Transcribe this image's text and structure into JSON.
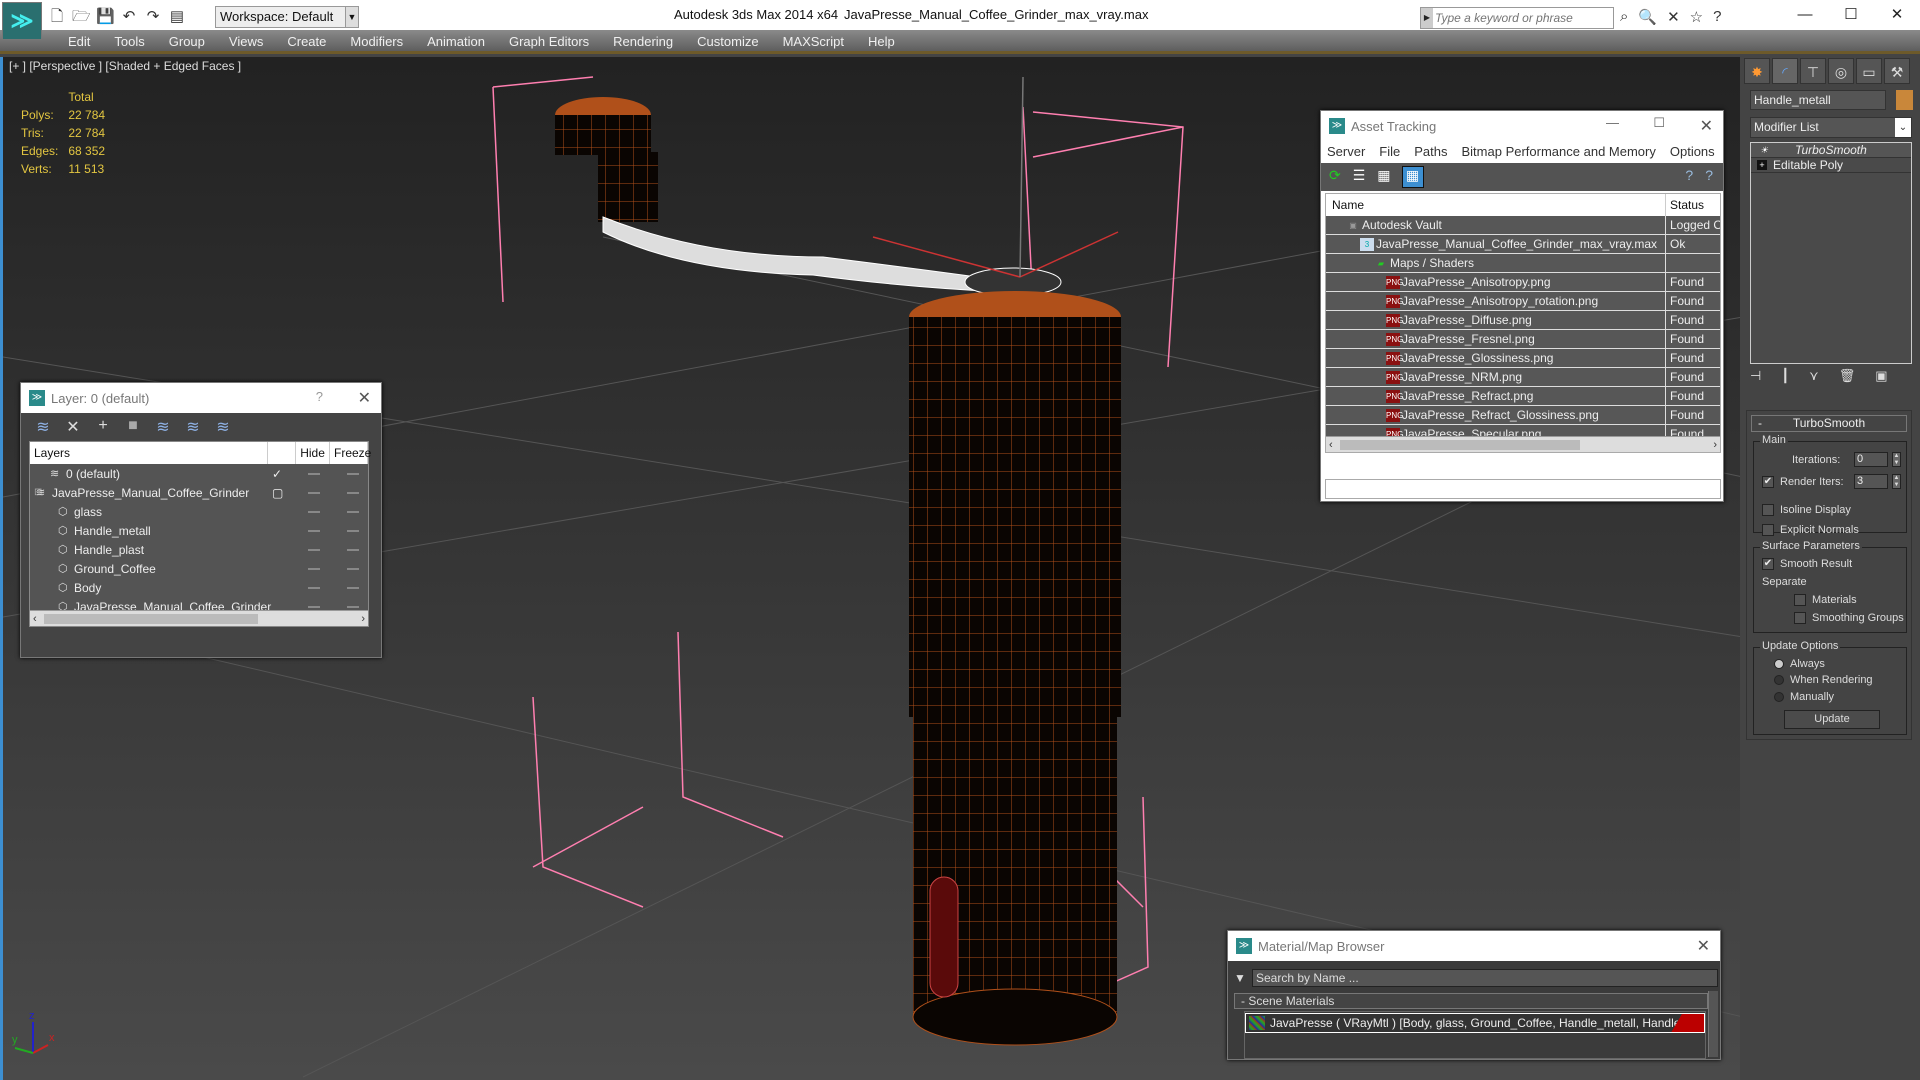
{
  "titlebar": {
    "app_title": "Autodesk 3ds Max  2014 x64",
    "file_title": "JavaPresse_Manual_Coffee_Grinder_max_vray.max",
    "workspace": "Workspace: Default",
    "search_placeholder": "Type a keyword or phrase",
    "quick_access_icons": [
      "new-file-icon",
      "open-file-icon",
      "save-icon",
      "undo-icon",
      "redo-icon",
      "project-folder-icon"
    ],
    "help_icons": [
      "binoculars-icon",
      "search-icon",
      "communication-icon",
      "favorites-icon",
      "help-icon"
    ],
    "window_controls": [
      "minimize",
      "maximize",
      "close"
    ]
  },
  "menu": [
    "Edit",
    "Tools",
    "Group",
    "Views",
    "Create",
    "Modifiers",
    "Animation",
    "Graph Editors",
    "Rendering",
    "Customize",
    "MAXScript",
    "Help"
  ],
  "viewport": {
    "label": "[+ ] [Perspective ] [Shaded + Edged Faces ]",
    "stats": {
      "header": "Total",
      "rows": [
        {
          "label": "Polys:",
          "value": "22 784"
        },
        {
          "label": "Tris:",
          "value": "22 784"
        },
        {
          "label": "Edges:",
          "value": "68 352"
        },
        {
          "label": "Verts:",
          "value": "11 513"
        }
      ]
    },
    "axis_labels": {
      "x": "x",
      "y": "y",
      "z": "z"
    }
  },
  "layer_panel": {
    "title": "Layer: 0 (default)",
    "help": "?",
    "columns": [
      "Layers",
      "Hide",
      "Freeze"
    ],
    "rows": [
      {
        "name": "0 (default)",
        "type": "layer",
        "indent": 1,
        "current": "check"
      },
      {
        "name": "JavaPresse_Manual_Coffee_Grinder",
        "type": "layer",
        "indent": 0,
        "current": "box",
        "expanded": true
      },
      {
        "name": "glass",
        "type": "object",
        "indent": 2
      },
      {
        "name": "Handle_metall",
        "type": "object",
        "indent": 2
      },
      {
        "name": "Handle_plast",
        "type": "object",
        "indent": 2
      },
      {
        "name": "Ground_Coffee",
        "type": "object",
        "indent": 2
      },
      {
        "name": "Body",
        "type": "object",
        "indent": 2
      },
      {
        "name": "JavaPresse_Manual_Coffee_Grinder",
        "type": "object",
        "indent": 2
      }
    ]
  },
  "asset_tracking": {
    "title": "Asset Tracking",
    "menu": [
      "Server",
      "File",
      "Paths",
      "Bitmap Performance and Memory",
      "Options"
    ],
    "columns": [
      "Name",
      "Status"
    ],
    "rows": [
      {
        "name": "Autodesk Vault",
        "status": "Logged Out",
        "icon": "vault",
        "indent": 0
      },
      {
        "name": "JavaPresse_Manual_Coffee_Grinder_max_vray.max",
        "status": "Ok",
        "icon": "max",
        "indent": 1
      },
      {
        "name": "Maps / Shaders",
        "status": "",
        "icon": "maps",
        "indent": 2
      },
      {
        "name": "JavaPresse_Anisotropy.png",
        "status": "Found",
        "icon": "png",
        "indent": 3
      },
      {
        "name": "JavaPresse_Anisotropy_rotation.png",
        "status": "Found",
        "icon": "png",
        "indent": 3
      },
      {
        "name": "JavaPresse_Diffuse.png",
        "status": "Found",
        "icon": "png",
        "indent": 3
      },
      {
        "name": "JavaPresse_Fresnel.png",
        "status": "Found",
        "icon": "png",
        "indent": 3
      },
      {
        "name": "JavaPresse_Glossiness.png",
        "status": "Found",
        "icon": "png",
        "indent": 3
      },
      {
        "name": "JavaPresse_NRM.png",
        "status": "Found",
        "icon": "png",
        "indent": 3
      },
      {
        "name": "JavaPresse_Refract.png",
        "status": "Found",
        "icon": "png",
        "indent": 3
      },
      {
        "name": "JavaPresse_Refract_Glossiness.png",
        "status": "Found",
        "icon": "png",
        "indent": 3
      },
      {
        "name": "JavaPresse_Specular.png",
        "status": "Found",
        "icon": "png",
        "indent": 3
      }
    ]
  },
  "material_browser": {
    "title": "Material/Map Browser",
    "search_placeholder": "Search by Name ...",
    "section": "- Scene Materials",
    "item": "JavaPresse  ( VRayMtl )  [Body, glass, Ground_Coffee, Handle_metall, Handle_plast]"
  },
  "command_panel": {
    "tabs": [
      "create",
      "modify",
      "hierarchy",
      "motion",
      "display",
      "utilities"
    ],
    "object_name": "Handle_metall",
    "object_color": "#c9873a",
    "modifier_list": "Modifier List",
    "stack": [
      "TurboSmooth",
      "Editable Poly"
    ],
    "turbosmooth": {
      "title": "TurboSmooth",
      "main_label": "Main",
      "iterations_label": "Iterations:",
      "iterations": "0",
      "render_iters_label": "Render Iters:",
      "render_iters": "3",
      "render_iters_checked": true,
      "isoline_label": "Isoline Display",
      "explicit_normals_label": "Explicit Normals",
      "surface_label": "Surface Parameters",
      "smooth_result_label": "Smooth Result",
      "separate_label": "Separate",
      "materials_label": "Materials",
      "smoothing_groups_label": "Smoothing Groups",
      "update_label": "Update Options",
      "always_label": "Always",
      "when_rendering_label": "When Rendering",
      "manually_label": "Manually",
      "update_button": "Update"
    }
  }
}
